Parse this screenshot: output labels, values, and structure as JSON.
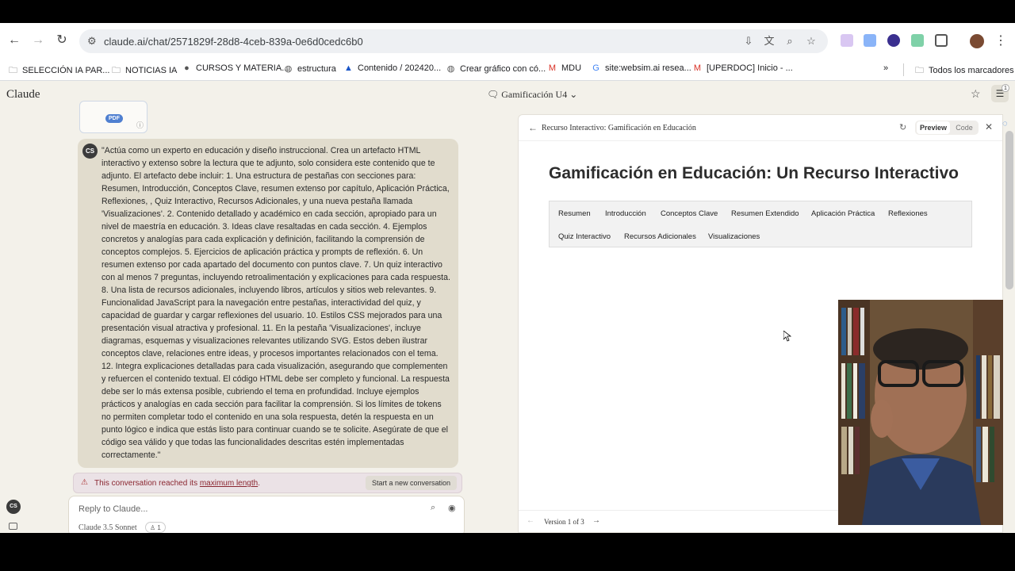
{
  "browser": {
    "url": "claude.ai/chat/2571829f-28d8-4ceb-839a-0e6d0cedc6b0",
    "bookmarks": [
      {
        "label": "SELECCIÓN IA PAR...",
        "icon": "folder-icon"
      },
      {
        "label": "NOTICIAS IA",
        "icon": "folder-icon"
      },
      {
        "label": "CURSOS Y MATERIA...",
        "icon": "github-icon"
      },
      {
        "label": "estructura",
        "icon": "globe-icon"
      },
      {
        "label": "Contenido / 202420...",
        "icon": "site-icon"
      },
      {
        "label": "Crear gráfico con có...",
        "icon": "globe-icon"
      },
      {
        "label": "MDU",
        "icon": "gmail-icon"
      },
      {
        "label": "site:websim.ai resea...",
        "icon": "google-icon"
      },
      {
        "label": "[UPERDOC] Inicio - ...",
        "icon": "gmail-icon"
      }
    ],
    "all_bookmarks": "Todos los marcadores"
  },
  "app": {
    "name": "Claude",
    "conversation_title": "Gamificación U4",
    "tune_badge": "1"
  },
  "chat": {
    "attachment_badge": "PDF",
    "user_initials": "CS",
    "message": "\"Actúa como un experto en educación y diseño instruccional. Crea un artefacto HTML interactivo y extenso sobre la lectura que te adjunto, solo considera este contenido que te adjunto. El artefacto debe incluir: 1. Una estructura de pestañas con secciones para: Resumen, Introducción, Conceptos Clave, resumen extenso por capítulo, Aplicación Práctica, Reflexiones, , Quiz Interactivo, Recursos Adicionales, y una nueva pestaña llamada 'Visualizaciones'. 2. Contenido detallado y académico en cada sección, apropiado para un nivel de maestría en educación. 3. Ideas clave resaltadas en cada sección. 4. Ejemplos concretos y analogías para cada explicación y definición, facilitando la comprensión de conceptos complejos. 5. Ejercicios de aplicación práctica y prompts de reflexión. 6. Un resumen extenso por cada apartado del documento con puntos clave. 7. Un quiz interactivo con al menos 7 preguntas, incluyendo retroalimentación y explicaciones para cada respuesta. 8. Una lista de recursos adicionales, incluyendo libros, artículos y sitios web relevantes. 9. Funcionalidad JavaScript para la navegación entre pestañas, interactividad del quiz, y capacidad de guardar y cargar reflexiones del usuario. 10. Estilos CSS mejorados para una presentación visual atractiva y profesional. 11. En la pestaña 'Visualizaciones', incluye diagramas, esquemas y visualizaciones relevantes utilizando SVG. Estos deben ilustrar conceptos clave, relaciones entre ideas, y procesos importantes relacionados con el tema. 12. Integra explicaciones detalladas para cada visualización, asegurando que complementen y refuercen el contenido textual. El código HTML debe ser completo y funcional. La respuesta debe ser lo más extensa posible, cubriendo el tema en profundidad. Incluye ejemplos prácticos y analogías en cada sección para facilitar la comprensión. Si los límites de tokens no permiten completar todo el contenido en una sola respuesta, detén la respuesta en un punto lógico e indica que estás listo para continuar cuando se te solicite. Asegúrate de que el código sea válido y que todas las funcionalidades descritas estén implementadas correctamente.\"",
    "limit_text_before": "This conversation reached its ",
    "limit_link": "maximum length",
    "limit_text_after": ".",
    "new_conversation": "Start a new conversation",
    "reply_placeholder": "Reply to Claude...",
    "model": "Claude 3.5 Sonnet",
    "user_count": "1"
  },
  "artifact": {
    "title": "Recurso Interactivo: Gamificación en Educación",
    "preview_label": "Preview",
    "code_label": "Code",
    "heading": "Gamificación en Educación: Un Recurso Interactivo",
    "tabs_row1": [
      "Resumen",
      "Introducción",
      "Conceptos Clave",
      "Resumen Extendido",
      "Aplicación Práctica",
      "Reflexiones"
    ],
    "tabs_row2": [
      "Quiz Interactivo",
      "Recursos Adicionales",
      "Visualizaciones"
    ],
    "version": "Version 1 of 3"
  },
  "colors": {
    "page_bg": "#f3f1ea",
    "bubble_bg": "#e1dccd",
    "limit_text": "#8a2630",
    "pdf_badge": "#4f7fd0"
  }
}
